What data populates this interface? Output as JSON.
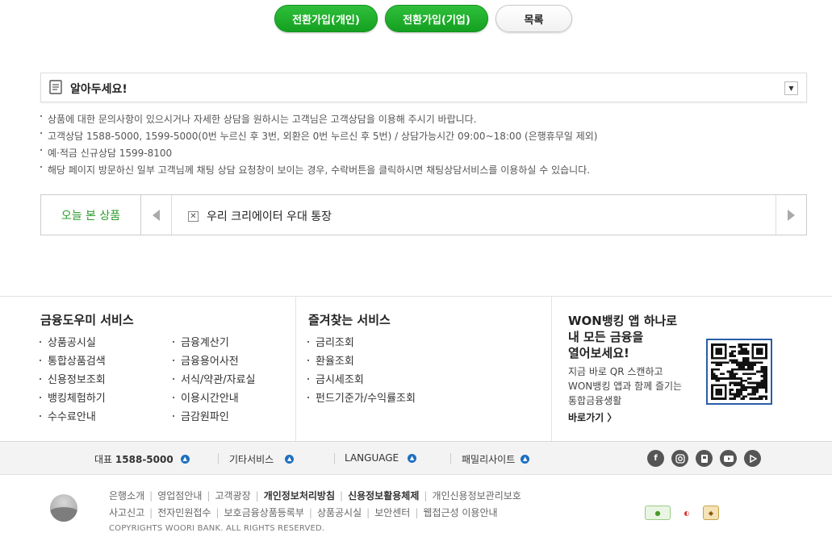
{
  "top_buttons": {
    "switch_personal": "전환가입(개인)",
    "switch_business": "전환가입(기업)",
    "list": "목록"
  },
  "notice": {
    "title": "알아두세요!",
    "items": [
      "상품에 대한 문의사항이 있으시거나 자세한 상담을 원하시는 고객님은 고객상담을 이용해 주시기 바랍니다.",
      "고객상담 1588-5000, 1599-5000(0번 누르신 후 3번, 외환은 0번 누르신 후 5번) / 상담가능시간 09:00~18:00 (은행휴무일 제외)",
      "예·적금 신규상담 1599-8100",
      "해당 페이지 방문하신 일부 고객님께 채팅 상담 요청창이 보이는 경우, 수락버튼을 클릭하시면 채팅상담서비스를 이용하실 수 있습니다."
    ]
  },
  "recent": {
    "label": "오늘 본 상품",
    "item_title": "우리 크리에이터 우대 통장",
    "remove_glyph": "✕"
  },
  "services": {
    "title": "금융도우미 서비스",
    "col1": [
      "상품공시실",
      "통합상품검색",
      "신용정보조회",
      "뱅킹체험하기",
      "수수료안내"
    ],
    "col2": [
      "금융계산기",
      "금융용어사전",
      "서식/약관/자료실",
      "이용시간안내",
      "금감원파인"
    ]
  },
  "favorites": {
    "title": "즐겨찾는 서비스",
    "items": [
      "금리조회",
      "환율조회",
      "금시세조회",
      "펀드기준가/수익률조회"
    ]
  },
  "app_promo": {
    "title": "WON뱅킹 앱 하나로\n내 모든 금융을\n열어보세요!",
    "desc": "지금 바로 QR 스캔하고\nWON뱅킹 앱과 함께 즐기는\n통합금융생활",
    "link": "바로가기 〉"
  },
  "footer_bar": {
    "phone_label": "대표",
    "phone_number": "1588-5000",
    "other_services": "기타서비스",
    "language": "LANGUAGE",
    "family_sites": "패밀리사이트",
    "social": [
      "facebook-icon",
      "instagram-icon",
      "blog-icon",
      "youtube-icon",
      "play-icon"
    ]
  },
  "bottom_links": {
    "row1": [
      {
        "text": "은행소개",
        "bold": false
      },
      {
        "text": "영업점안내",
        "bold": false
      },
      {
        "text": "고객광장",
        "bold": false
      },
      {
        "text": "개인정보처리방침",
        "bold": true
      },
      {
        "text": "신용정보활용체제",
        "bold": true
      },
      {
        "text": "개인신용정보관리보호",
        "bold": false
      }
    ],
    "row2": [
      {
        "text": "사고신고",
        "bold": false
      },
      {
        "text": "전자민원접수",
        "bold": false
      },
      {
        "text": "보호금융상품등록부",
        "bold": false
      },
      {
        "text": "상품공시실",
        "bold": false
      },
      {
        "text": "보안센터",
        "bold": false
      },
      {
        "text": "웹접근성 이용안내",
        "bold": false
      }
    ]
  },
  "copyright": "COPYRIGHTS WOORI BANK. ALL RIGHTS RESERVED.",
  "colors": {
    "accent_green": "#14a020",
    "link_blue": "#1e6fc0"
  }
}
